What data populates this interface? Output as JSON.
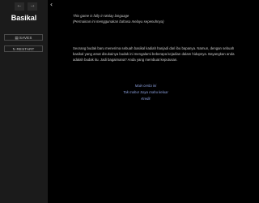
{
  "sidebar": {
    "nav_back_glyph": "←",
    "nav_forward_glyph": "→",
    "title": "Basikal",
    "saves_icon": "▤",
    "saves_label": "SAVES",
    "restart_icon": "↻",
    "restart_label": "RESTART",
    "collapse_glyph": "‹"
  },
  "passage": {
    "intro_line_1": "This game is fully in Malay language",
    "intro_line_2": "(Permainan ini menggunakan bahasa melayu sepenuhnya)",
    "story": "Seorang budak baru menerima sebuah basikal kadiah hanjadi dari ibu bapanya. Namun, dengan sebuah basikal yang amat disukainya budak ini mengalami beberapa kejadian dalam hidupnya. Bayangkan anda adalah budak itu. Jadi bagaimana? Anda yang membuat keputusan."
  },
  "choices": [
    {
      "label": "Main cerita ini"
    },
    {
      "label": "Tak mahu! Saya mahu keluar"
    },
    {
      "label": "Kredit"
    }
  ],
  "colors": {
    "background": "#000000",
    "sidebar": "#1b1b1b",
    "link": "#8ea2e0",
    "text": "#c8c8c8"
  }
}
